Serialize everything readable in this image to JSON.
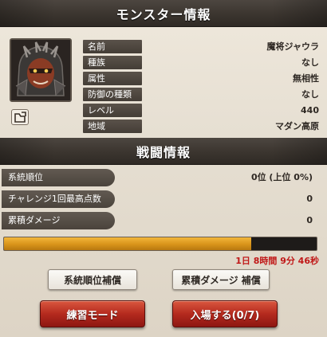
{
  "monster_info": {
    "title": "モンスター情報",
    "rows": [
      {
        "label": "名前",
        "value": "魔将ジャウラ"
      },
      {
        "label": "種族",
        "value": "なし"
      },
      {
        "label": "属性",
        "value": "無相性"
      },
      {
        "label": "防御の種類",
        "value": "なし"
      },
      {
        "label": "レベル",
        "value": "440"
      },
      {
        "label": "地域",
        "value": "マダン高原"
      }
    ]
  },
  "battle_info": {
    "title": "戦闘情報",
    "rows": [
      {
        "label": "系統順位",
        "value": "0位 (上位 0%)"
      },
      {
        "label": "チャレンジ1回最高点数",
        "value": "0"
      },
      {
        "label": "累積ダメージ",
        "value": "0"
      }
    ],
    "progress_fraction": 0.79,
    "timer": "1日 8時間 9分 46秒"
  },
  "buttons": {
    "rank_reward": "系統順位補償",
    "damage_reward": "累積ダメージ 補償",
    "practice": "練習モード",
    "enter": "入場する(0/7)"
  },
  "colors": {
    "progress": "#d8941a",
    "timer": "#c01818",
    "action_button": "#b42a1e"
  },
  "icons": {
    "portrait": "monster-portrait",
    "share": "share-icon"
  }
}
